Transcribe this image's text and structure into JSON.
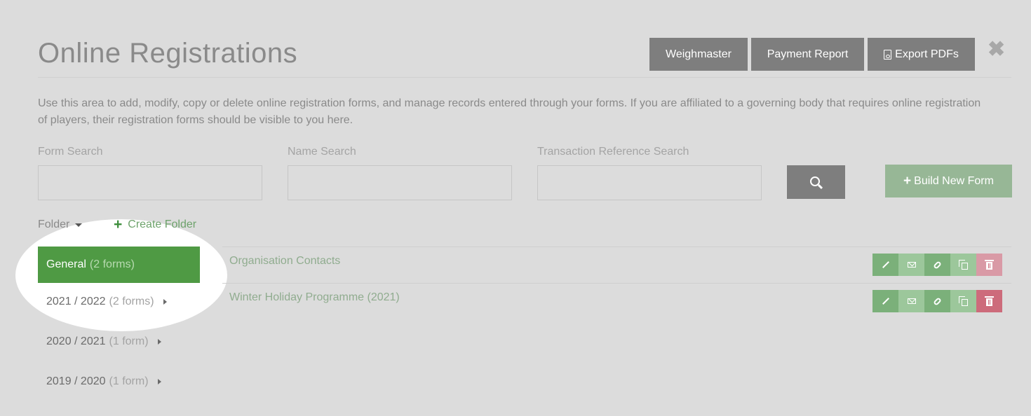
{
  "page": {
    "title": "Online Registrations",
    "intro": "Use this area to add, modify, copy or delete online registration forms, and manage records entered through your forms. If you are affiliated to a governing body that requires online registration of players, their registration forms should be visible to you here."
  },
  "header": {
    "weighmaster_label": "Weighmaster",
    "payment_report_label": "Payment Report",
    "export_pdfs_label": "Export PDFs",
    "close_icon": "close-icon"
  },
  "search": {
    "form_label": "Form Search",
    "form_value": "",
    "name_label": "Name Search",
    "name_value": "",
    "transaction_label": "Transaction Reference Search",
    "transaction_value": ""
  },
  "toolbar": {
    "build_new_form_label": "Build New Form",
    "folder_label": "Folder",
    "create_folder_label": "Create Folder"
  },
  "folders": [
    {
      "name": "General",
      "count": "(2 forms)"
    },
    {
      "name": "2021 / 2022",
      "count": "(2 forms)"
    },
    {
      "name": "2020 / 2021",
      "count": "(1 form)"
    },
    {
      "name": "2019 / 2020",
      "count": "(1 form)"
    }
  ],
  "forms": [
    {
      "name": "Organisation Contacts"
    },
    {
      "name": "Winter Holiday Programme (2021)"
    }
  ],
  "colors": {
    "active_folder": "#4f9a44",
    "action_green": "#7bb07a",
    "action_delete": "#cd6b7b",
    "header_button": "#7e7e7e"
  }
}
